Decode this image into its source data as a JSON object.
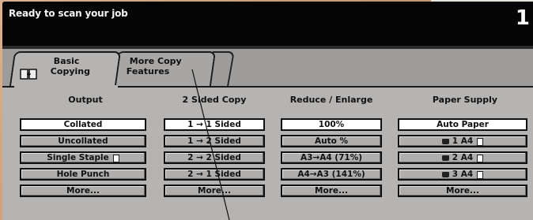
{
  "status": {
    "message": "Ready to scan your job",
    "copy_count": "1"
  },
  "tabs": [
    {
      "line1": "Basic",
      "line2": "Copying",
      "icon": "copy-icon"
    },
    {
      "line1": "More Copy",
      "line2": "Features"
    }
  ],
  "columns": [
    {
      "header": "Output",
      "options": [
        {
          "label": "Collated",
          "selected": true
        },
        {
          "label": "Uncollated",
          "selected": false
        },
        {
          "label": "Single Staple",
          "selected": false,
          "icon": "document-icon"
        },
        {
          "label": "Hole Punch",
          "selected": false
        },
        {
          "label": "More...",
          "selected": false
        }
      ]
    },
    {
      "header": "2 Sided Copy",
      "options": [
        {
          "label": "1 → 1 Sided",
          "selected": true
        },
        {
          "label": "1 → 2 Sided",
          "selected": false
        },
        {
          "label": "2 → 2 Sided",
          "selected": false
        },
        {
          "label": "2 → 1 Sided",
          "selected": false
        },
        {
          "label": "More...",
          "selected": false
        }
      ]
    },
    {
      "header": "Reduce / Enlarge",
      "options": [
        {
          "label": "100%",
          "selected": true
        },
        {
          "label": "Auto %",
          "selected": false
        },
        {
          "label": "A3→A4 (71%)",
          "selected": false
        },
        {
          "label": "A4→A3 (141%)",
          "selected": false
        },
        {
          "label": "More...",
          "selected": false
        }
      ]
    },
    {
      "header": "Paper Supply",
      "options": [
        {
          "label": "Auto Paper",
          "selected": true
        },
        {
          "label": "1 A4",
          "selected": false,
          "icon": "tray-icon"
        },
        {
          "label": "2 A4",
          "selected": false,
          "icon": "tray-icon"
        },
        {
          "label": "3 A4",
          "selected": false,
          "icon": "tray-icon"
        },
        {
          "label": "More...",
          "selected": false
        }
      ]
    }
  ],
  "colors": {
    "panel": "#b6b4b2",
    "button": "#b0aeac",
    "selected": "#ffffff",
    "status_bg": "#050505"
  }
}
